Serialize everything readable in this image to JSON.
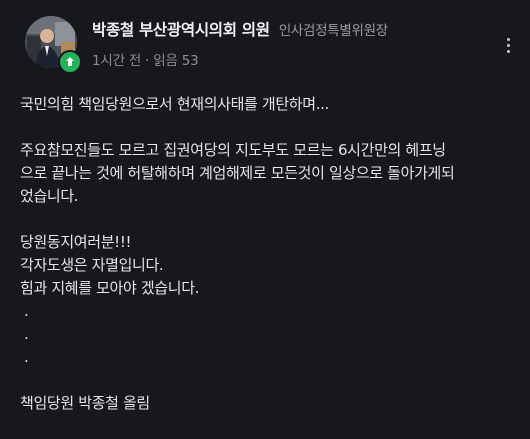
{
  "author": {
    "name": "박종철 부산광역시의회 의원",
    "role": "인사검정특별위원장",
    "avatar": "profile-photo",
    "badge_icon": "leaf-icon"
  },
  "meta": {
    "time": "1시간 전",
    "separator": "·",
    "views": "읽음 53"
  },
  "more_icon": "more-vertical-icon",
  "content": {
    "line1": "국민의힘 책임당원으로서 현재의사태를 개탄하며...",
    "para2": [
      "주요참모진들도 모르고 집권여당의 지도부도 모르는 6시간만의 헤프닝",
      "으로 끝나는 것에 허탈해하며 계엄해제로 모든것이 일상으로 돌아가게되",
      "었습니다."
    ],
    "para3": [
      "당원동지여러분!!!",
      "각자도생은 자멸입니다.",
      "힘과 지혜를 모아야 겠습니다."
    ],
    "dots": [
      ".",
      ".",
      "."
    ],
    "signature": "책임당원 박종철 올림"
  },
  "colors": {
    "background": "#17181c",
    "badge": "#25b15a"
  }
}
